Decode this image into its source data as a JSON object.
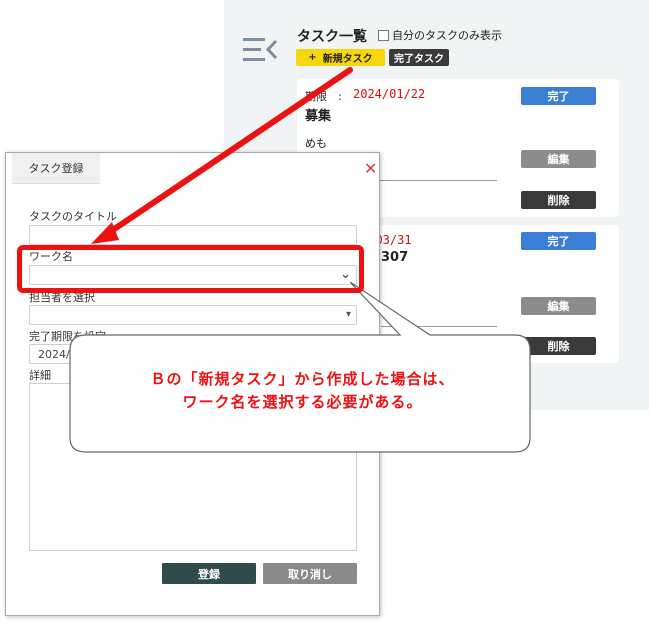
{
  "app": {
    "title": "タスク一覧",
    "own_tasks_only_label": "自分のタスクのみ表示",
    "new_task_button": "新規タスク",
    "new_task_plus": "+",
    "completed_tasks_button": "完了タスク"
  },
  "cards": [
    {
      "due_label": "期限　:",
      "due_date": "2024/01/22",
      "title": "募集",
      "memo": "めも",
      "done_label": "完了",
      "edit_label": "編集",
      "delete_label": "削除"
    },
    {
      "due_date_partial": "4/03/31",
      "title_partial": "307",
      "done_label": "完了",
      "edit_label": "編集",
      "delete_label": "削除"
    }
  ],
  "dialog": {
    "tab_label": "タスク登録",
    "close_glyph": "✕",
    "task_title_label": "タスクのタイトル",
    "work_name_label": "ワーク名",
    "assignee_label": "担当者を選択",
    "due_label": "完了期限を設定",
    "due_value_partial": "2024/",
    "detail_label": "詳細",
    "register_button": "登録",
    "cancel_button": "取り消し"
  },
  "callout": {
    "line1": "Ｂの「新規タスク」から作成した場合は、",
    "line2": "ワーク名を選択する必要がある。"
  },
  "colors": {
    "highlight": "#ee1111",
    "new_task_yellow": "#f5d60f",
    "done_blue": "#3a7fd5",
    "register_dark": "#2f4b4b"
  },
  "icons": [
    "menu-collapse-icon",
    "close-icon",
    "chevron-down-icon"
  ]
}
